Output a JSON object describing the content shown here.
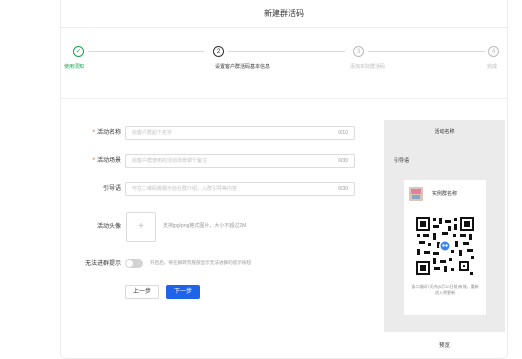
{
  "dialog": {
    "title": "新建群活码"
  },
  "steps": [
    {
      "num": "✓",
      "label": "使用须知",
      "state": "done"
    },
    {
      "num": "2",
      "label": "设置客户群活码基本信息",
      "state": "active"
    },
    {
      "num": "3",
      "label": "添加实际群活码",
      "state": "pending"
    },
    {
      "num": "4",
      "label": "完成",
      "state": "pending"
    }
  ],
  "form": {
    "name": {
      "label": "活动名称",
      "placeholder": "给客户群起个名字",
      "count": "0/10",
      "required": true
    },
    "scene": {
      "label": "活动场景",
      "placeholder": "给客户群使用的活动场景做个备注",
      "count": "0/30",
      "required": true
    },
    "guide": {
      "label": "引导语",
      "placeholder": "可在二维码旁展示给社群介绍，入群引导等内容",
      "count": "0/30",
      "required": false
    },
    "avatar": {
      "label": "活动头像",
      "plus": "+",
      "hint": "支持jpg/png格式图片，大小不超过2M"
    },
    "full_tip": {
      "label": "无法进群提示",
      "hint": "开启后，将在群转页底部显示无法进群的提示按钮"
    }
  },
  "buttons": {
    "prev": "上一步",
    "next": "下一步"
  },
  "preview": {
    "title": "活动名称",
    "guide_label": "引导语",
    "group_name": "实例群名称",
    "qr_hint": "该二维码7天内(5月10日前)有效，重新进入将更新",
    "footer": "预览"
  },
  "colors": {
    "primary": "#1f63e8",
    "done": "#16a34a",
    "required": "#e33333"
  }
}
